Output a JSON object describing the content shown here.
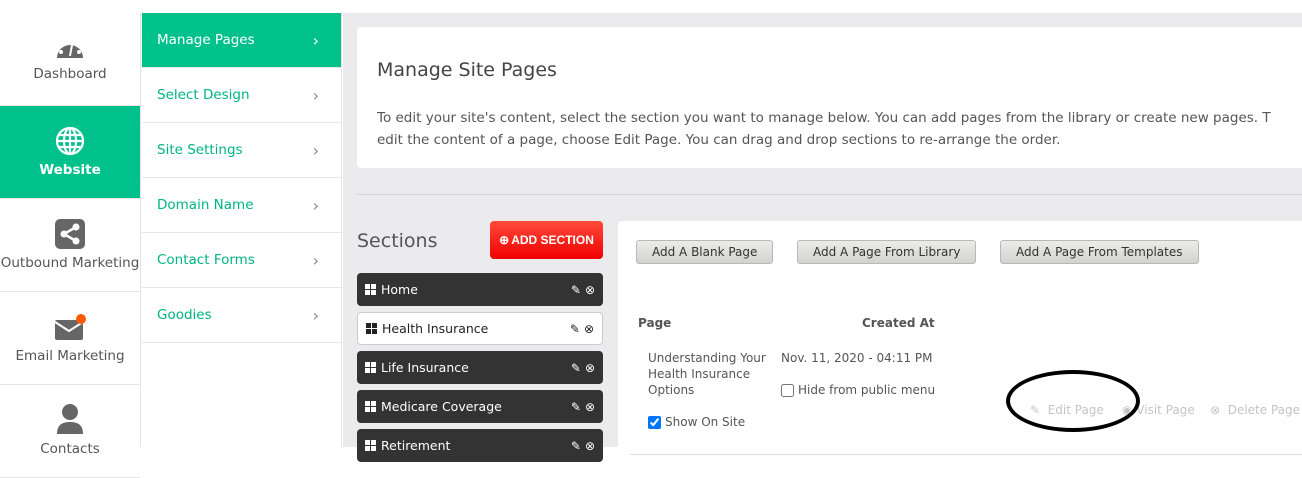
{
  "nav": [
    {
      "label": "Dashboard",
      "icon": "dashboard-icon"
    },
    {
      "label": "Website",
      "icon": "globe-icon",
      "active": true
    },
    {
      "label": "Outbound Marketing",
      "icon": "share-icon"
    },
    {
      "label": "Email Marketing",
      "icon": "envelope-icon"
    },
    {
      "label": "Contacts",
      "icon": "user-icon"
    }
  ],
  "submenu": [
    {
      "label": "Manage Pages",
      "active": true
    },
    {
      "label": "Select Design"
    },
    {
      "label": "Site Settings"
    },
    {
      "label": "Domain Name"
    },
    {
      "label": "Contact Forms"
    },
    {
      "label": "Goodies"
    }
  ],
  "header": {
    "title": "Manage Site Pages",
    "line1": "To edit your site's content, select the section you want to manage below. You can add pages from the library or create new pages. T",
    "line2": "edit the content of a page, choose Edit Page. You can drag and drop sections to re-arrange the order."
  },
  "sections": {
    "title": "Sections",
    "add_label": "ADD SECTION",
    "items": [
      "Home",
      "Health Insurance",
      "Life Insurance",
      "Medicare Coverage",
      "Retirement"
    ]
  },
  "pages": {
    "buttons": [
      "Add A Blank Page",
      "Add A Page From Library",
      "Add A Page From Templates"
    ],
    "col_page": "Page",
    "col_created": "Created At",
    "rows": [
      {
        "title": "Understanding Your Health Insurance Options",
        "title_l1": "Understanding Your",
        "title_l2": "Health Insurance",
        "title_l3": "Options",
        "created": "Nov. 11, 2020 - 04:11 PM",
        "hide_label": "Hide from public menu",
        "hide_checked": false,
        "show_label": "Show On Site",
        "show_checked": true,
        "edit": "Edit Page",
        "visit": "Visit Page",
        "delete": "Delete Page"
      }
    ]
  },
  "colors": {
    "accent": "#00c18c",
    "danger": "#ff1a0a",
    "notification": "#ff5a00"
  }
}
